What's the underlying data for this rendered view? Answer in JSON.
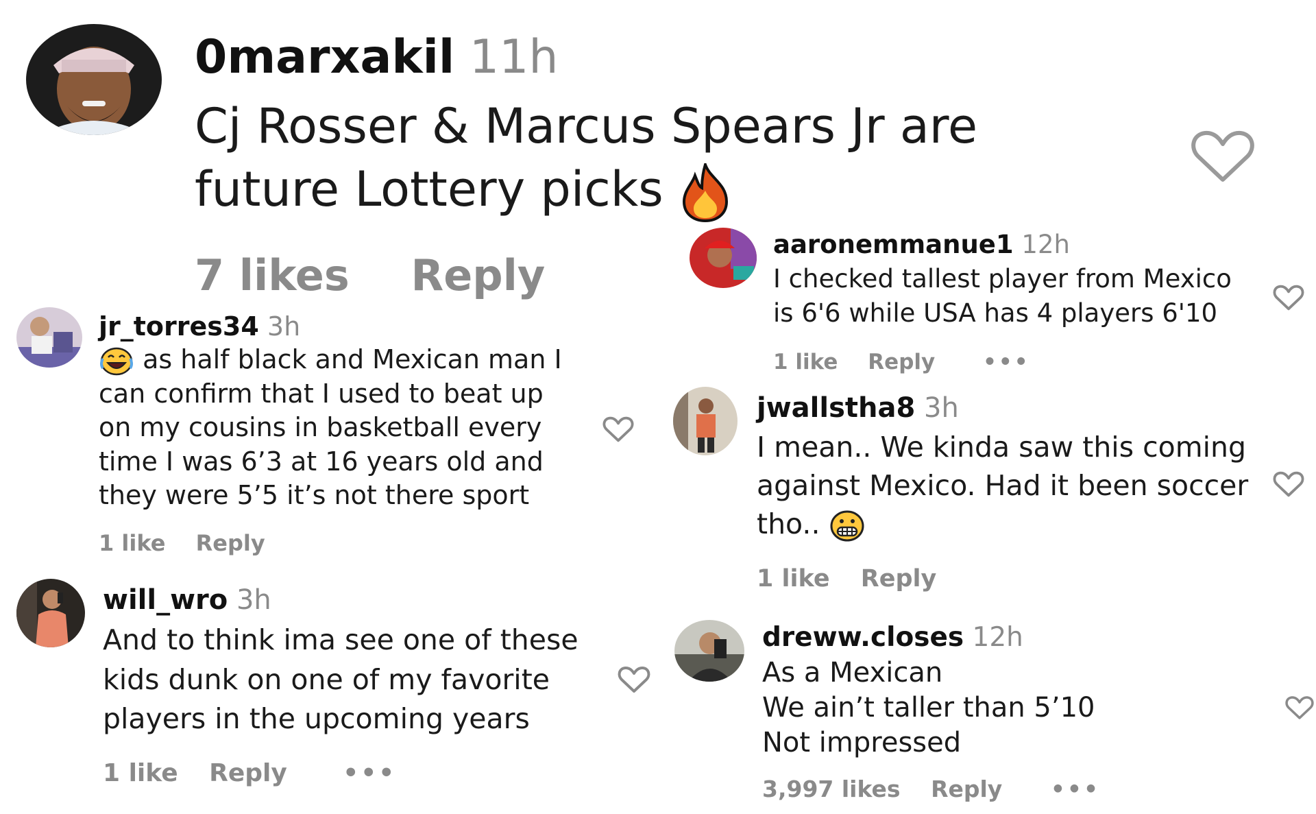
{
  "main_comment": {
    "username": "0marxakil",
    "time": "11h",
    "text_line1": "Cj Rosser & Marcus Spears Jr are",
    "text_line2": "future Lottery picks",
    "emoji": "fire-emoji",
    "likes": "7 likes",
    "reply": "Reply"
  },
  "comments": [
    {
      "username": "jr_torres34",
      "time": "3h",
      "lines": [
        "as half black and Mexican man I",
        "can confirm that I used to beat up",
        "on my cousins in basketball every",
        "time I was 6’3 at 16 years old and",
        "they were 5’5 it’s not there sport"
      ],
      "emoji": "laughing-tears-emoji",
      "likes": "1 like",
      "reply": "Reply"
    },
    {
      "username": "will_wro",
      "time": "3h",
      "lines": [
        "And to think ima see one of these",
        "kids dunk on one of my favorite",
        "players in the upcoming years"
      ],
      "likes": "1 like",
      "reply": "Reply",
      "more": "•••"
    },
    {
      "username": "aaronemmanue1",
      "time": "12h",
      "lines": [
        "I checked tallest player from Mexico",
        "is 6'6 while USA has 4 players 6'10"
      ],
      "likes": "1 like",
      "reply": "Reply",
      "more": "•••"
    },
    {
      "username": "jwallstha8",
      "time": "3h",
      "lines": [
        "I mean.. We kinda saw this coming",
        "against Mexico. Had it been soccer",
        "tho.."
      ],
      "emoji": "grimacing-emoji",
      "likes": "1 like",
      "reply": "Reply"
    },
    {
      "username": "dreww.closes",
      "time": "12h",
      "lines": [
        "As a Mexican",
        "We ain’t taller than 5’10",
        "Not impressed"
      ],
      "likes": "3,997 likes",
      "reply": "Reply",
      "more": "•••"
    }
  ],
  "icons": {
    "like": "heart-outline-icon",
    "more": "more-options-icon"
  }
}
